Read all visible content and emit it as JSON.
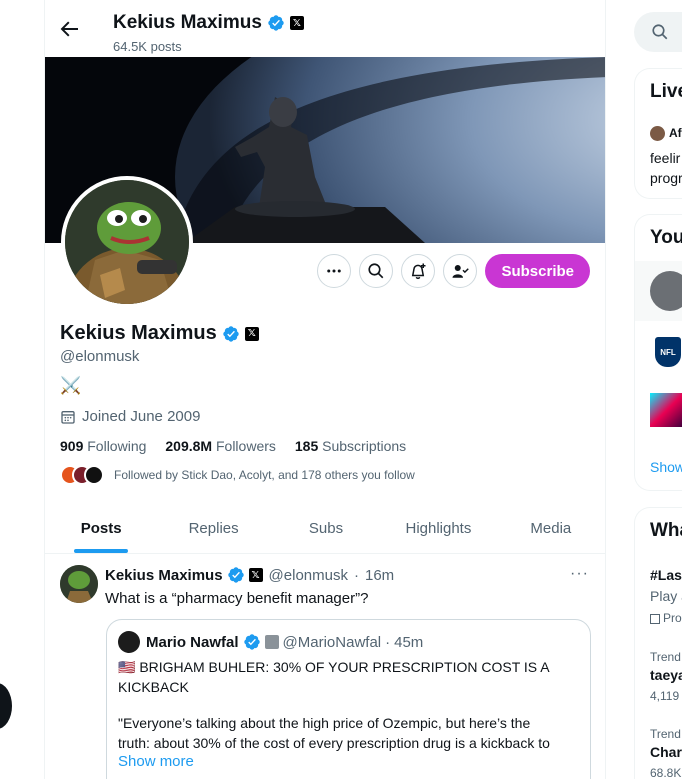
{
  "header": {
    "name": "Kekius Maximus",
    "posts_count": "64.5K posts"
  },
  "profile": {
    "name": "Kekius Maximus",
    "handle": "@elonmusk",
    "bio": "⚔️",
    "joined": "Joined June 2009",
    "following_count": "909",
    "following_label": "Following",
    "followers_count": "209.8M",
    "followers_label": "Followers",
    "subscriptions_count": "185",
    "subscriptions_label": "Subscriptions",
    "followed_by": "Followed by Stick Dao, Acolyt, and 178 others you follow",
    "subscribe_label": "Subscribe"
  },
  "tabs": [
    {
      "label": "Posts",
      "active": true
    },
    {
      "label": "Replies",
      "active": false
    },
    {
      "label": "Subs",
      "active": false
    },
    {
      "label": "Highlights",
      "active": false
    },
    {
      "label": "Media",
      "active": false
    }
  ],
  "tweet": {
    "name": "Kekius Maximus",
    "handle": "@elonmusk",
    "time": "16m",
    "text": "What is a “pharmacy benefit manager”?",
    "more": "···",
    "quote": {
      "name": "Mario Nawfal",
      "handle": "@MarioNawfal",
      "time": "45m",
      "line1": "🇺🇸 BRIGHAM BUHLER: 30% OF YOUR PRESCRIPTION COST IS A",
      "line2": "KICKBACK",
      "line3": "\"Everyone’s talking about the high price of Ozempic, but here’s the",
      "line4": "truth: about 30% of the cost of every prescription drug is a kickback to",
      "show_more": "Show more"
    }
  },
  "right_rail": {
    "live_title": "Live",
    "live_user": "Af",
    "live_text1": "feelir",
    "live_text2": "progr",
    "you_title": "You",
    "show_link": "Show",
    "what_title": "Wha",
    "trend1_tag": "#Las",
    "trend1_sub": "Play a",
    "trend1_promo": "Pro",
    "trend2_label": "Trend",
    "trend2_name": "taeya",
    "trend2_count": "4,119 p",
    "trend3_label": "Trend",
    "trend3_name": "Char",
    "trend3_count": "68.8K"
  },
  "colors": {
    "accent": "#1d9bf0",
    "subscribe": "#c936d3",
    "text_secondary": "#536471"
  }
}
